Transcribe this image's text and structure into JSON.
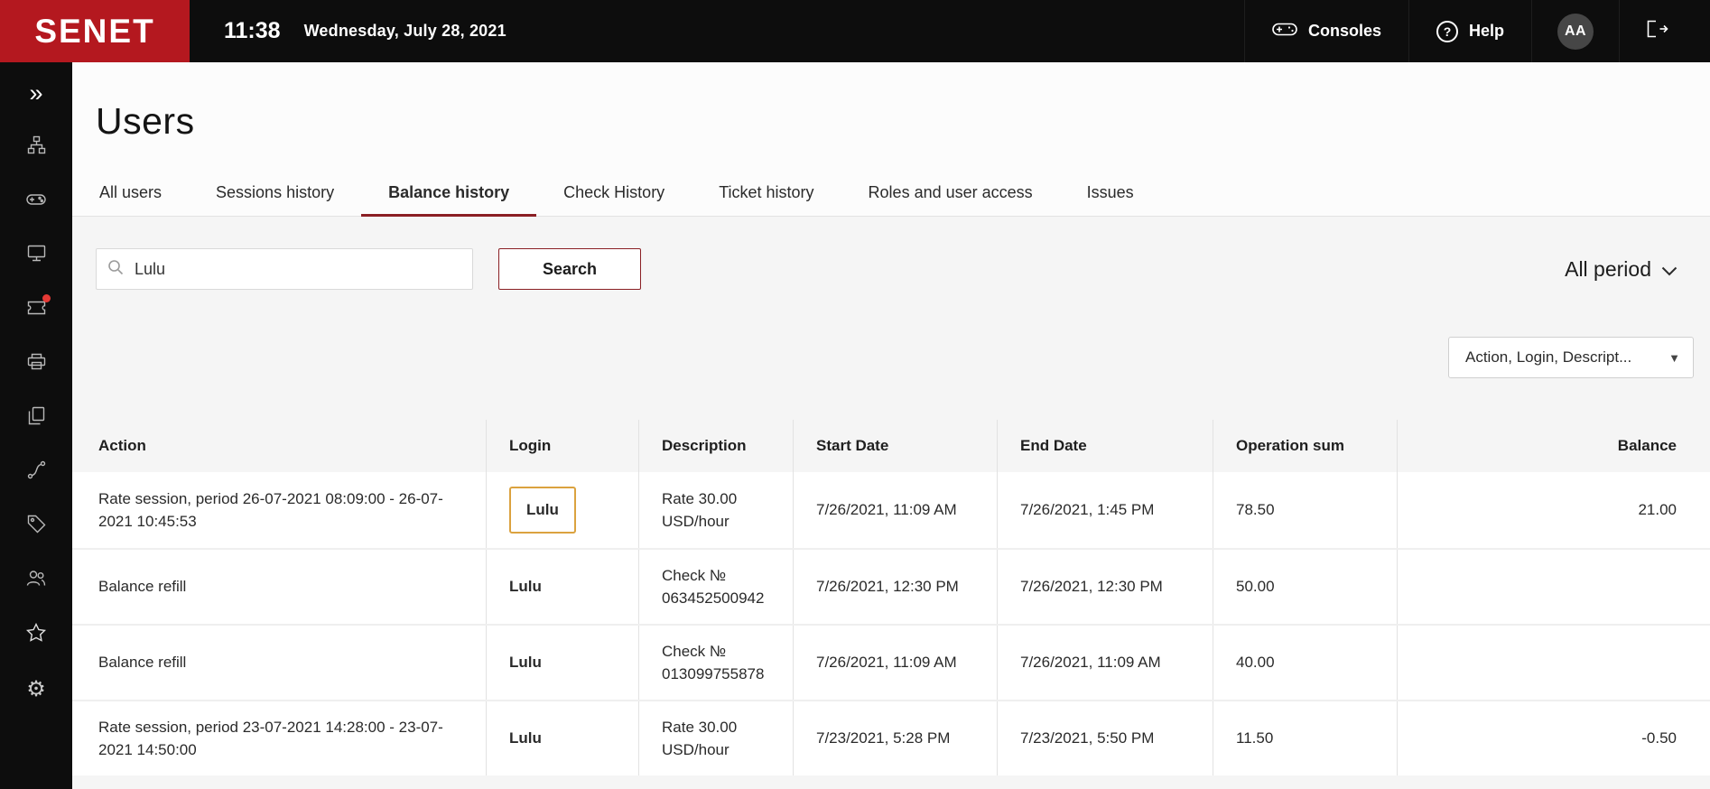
{
  "colors": {
    "brand-red": "#b4181f",
    "accent-maroon": "#8a1f24",
    "notify-red": "#e53935",
    "highlight-orange": "#dba23f"
  },
  "header": {
    "logo": "SENET",
    "time": "11:38",
    "date": "Wednesday, July 28, 2021",
    "consoles_label": "Consoles",
    "help_label": "Help",
    "avatar": "AA"
  },
  "sidebar": {
    "items": [
      "collapse-expand",
      "structure",
      "bookings",
      "computers",
      "tickets",
      "printing",
      "documents",
      "statistics",
      "tariffs",
      "users",
      "favorites",
      "settings"
    ],
    "notification_on": "tickets"
  },
  "page": {
    "title": "Users",
    "tabs": [
      {
        "label": "All users",
        "active": false
      },
      {
        "label": "Sessions history",
        "active": false
      },
      {
        "label": "Balance history",
        "active": true
      },
      {
        "label": "Check History",
        "active": false
      },
      {
        "label": "Ticket history",
        "active": false
      },
      {
        "label": "Roles and user access",
        "active": false
      },
      {
        "label": "Issues",
        "active": false
      }
    ],
    "search": {
      "value": "Lulu",
      "button": "Search",
      "period": "All period"
    },
    "columns_filter": "Action, Login, Descript...",
    "table": {
      "headers": [
        "Action",
        "Login",
        "Description",
        "Start Date",
        "End Date",
        "Operation sum",
        "Balance"
      ],
      "rows": [
        {
          "action": "Rate session, period 26-07-2021 08:09:00 - 26-07-2021 10:45:53",
          "login": "Lulu",
          "login_highlight": true,
          "description": "Rate 30.00 USD/hour",
          "start": "7/26/2021, 11:09 AM",
          "end": "7/26/2021, 1:45 PM",
          "sum": "78.50",
          "balance": "21.00"
        },
        {
          "action": "Balance refill",
          "login": "Lulu",
          "login_highlight": false,
          "description": "Check № 063452500942",
          "start": "7/26/2021, 12:30 PM",
          "end": "7/26/2021, 12:30 PM",
          "sum": "50.00",
          "balance": ""
        },
        {
          "action": "Balance refill",
          "login": "Lulu",
          "login_highlight": false,
          "description": "Check № 013099755878",
          "start": "7/26/2021, 11:09 AM",
          "end": "7/26/2021, 11:09 AM",
          "sum": "40.00",
          "balance": ""
        },
        {
          "action": "Rate session, period 23-07-2021 14:28:00 - 23-07-2021 14:50:00",
          "login": "Lulu",
          "login_highlight": false,
          "description": "Rate 30.00 USD/hour",
          "start": "7/23/2021, 5:28 PM",
          "end": "7/23/2021, 5:50 PM",
          "sum": "11.50",
          "balance": "-0.50"
        }
      ]
    }
  }
}
